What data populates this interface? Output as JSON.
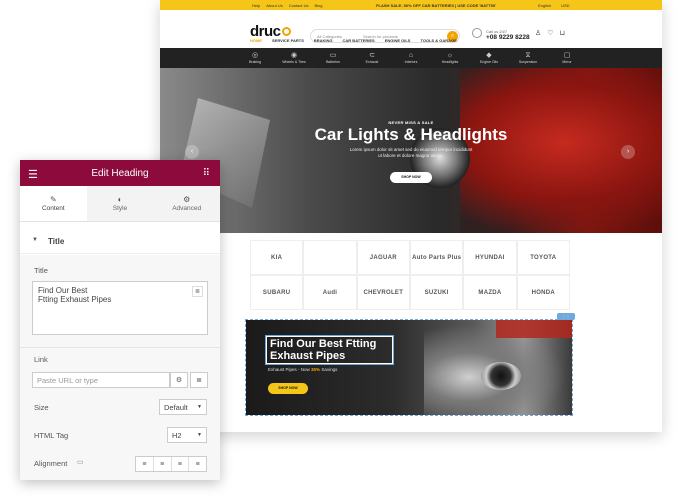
{
  "site": {
    "topbar": {
      "links": [
        "Help",
        "About Us",
        "Contact Us",
        "Blog"
      ],
      "promo": "⚡ FLASH SALE: 50% OFF CAR BATTERIES | USE CODE 'BATT50'",
      "language": "English",
      "currency": "USD"
    },
    "logo": "druc",
    "search": {
      "category": "All Categories",
      "placeholder": "Search for products"
    },
    "phone": {
      "label": "Call us 24/7",
      "number": "+08 9229 8228"
    },
    "nav": [
      "HOME",
      "SERVICE PARTS",
      "BRAKING",
      "CAR BATTERIES",
      "ENGINE OILS",
      "TOOLS & GARAGE"
    ],
    "categories": [
      {
        "icon": "brake-icon",
        "label": "Braking"
      },
      {
        "icon": "wheel-icon",
        "label": "Wheels & Tires"
      },
      {
        "icon": "battery-icon",
        "label": "Batteries"
      },
      {
        "icon": "exhaust-icon",
        "label": "Exhaust"
      },
      {
        "icon": "interior-icon",
        "label": "Interiors"
      },
      {
        "icon": "headlight-icon",
        "label": "Headlights"
      },
      {
        "icon": "engine-oil-icon",
        "label": "Engine Oils"
      },
      {
        "icon": "suspension-icon",
        "label": "Suspension"
      },
      {
        "icon": "mirror-icon",
        "label": "Mirror"
      }
    ],
    "hero": {
      "eyebrow": "NEVER MISS A SALE",
      "title": "Car Lights & Headlights",
      "subtitle_1": "Lorem ipsum dolor sit amet sed do eiusmod tempor incididunt",
      "subtitle_2": "ut labore et dolore magna aliqua.",
      "button": "SHOP NOW"
    },
    "brands": [
      "KIA",
      "",
      "JAGUAR",
      "Auto Parts Plus",
      "HYUNDAI",
      "TOYOTA",
      "SUBARU",
      "Audi",
      "CHEVROLET",
      "SUZUKI",
      "MAZDA",
      "HONDA"
    ],
    "banner": {
      "title_1": "Find Our Best Ftting",
      "title_2": "Exhaust Pipes",
      "sub_prefix": "Exhaust Pipes - Now",
      "sub_highlight": "35%",
      "sub_suffix": "Savings",
      "button": "SHOP NOW"
    }
  },
  "panel": {
    "title": "Edit Heading",
    "tabs": [
      {
        "label": "Content",
        "icon": "pencil-icon"
      },
      {
        "label": "Style",
        "icon": "half-circle-icon"
      },
      {
        "label": "Advanced",
        "icon": "gear-icon"
      }
    ],
    "section": "Title",
    "fields": {
      "title_label": "Title",
      "title_value_1": "Find Our Best",
      "title_value_2": "Ftting Exhaust Pipes",
      "link_label": "Link",
      "link_placeholder": "Paste URL or type",
      "size_label": "Size",
      "size_value": "Default",
      "tag_label": "HTML Tag",
      "tag_value": "H2",
      "alignment_label": "Alignment"
    }
  }
}
